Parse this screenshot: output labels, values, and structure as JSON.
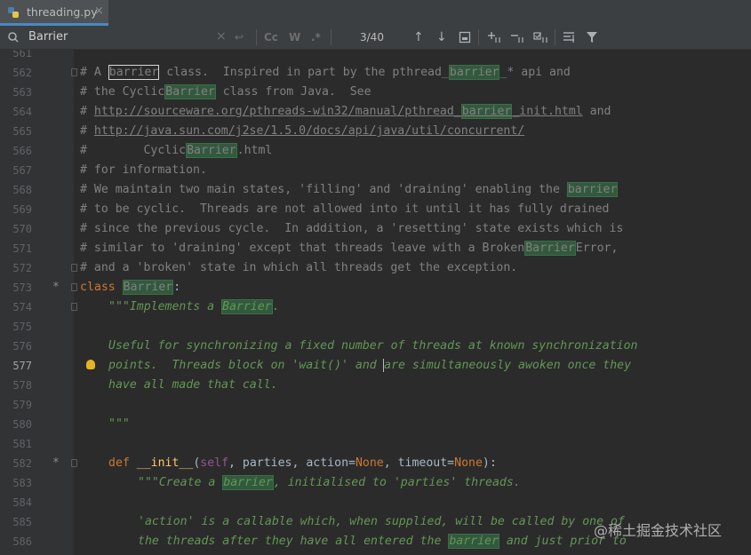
{
  "tab": {
    "filename": "threading.py",
    "close": "×"
  },
  "search": {
    "query": "Barrier",
    "match_count": "3/40",
    "clear_icon": "×",
    "history_icon": "↩",
    "match_case": "Cc",
    "whole_word": "W",
    "regex": ".*",
    "prev_icon": "↑",
    "next_icon": "↓"
  },
  "editor": {
    "current_line": "577",
    "lines": [
      {
        "n": "561"
      },
      {
        "n": "562",
        "a": "# A ",
        "b": "barrier",
        "c": " class.  Inspired in part by the pthread_",
        "d": "barrier",
        "e": "_* api and"
      },
      {
        "n": "563",
        "a": "# the Cyclic",
        "b": "Barrier",
        "c": " class from Java.  See"
      },
      {
        "n": "564",
        "a": "# ",
        "l1": "http://sourceware.org/pthreads-win32/manual/pthread_",
        "b": "barrier",
        "l2": "_init.html",
        "c": " and"
      },
      {
        "n": "565",
        "a": "# ",
        "l": "http://java.sun.com/j2se/1.5.0/docs/api/java/util/concurrent/"
      },
      {
        "n": "566",
        "a": "#        Cyclic",
        "b": "Barrier",
        "c": ".html"
      },
      {
        "n": "567",
        "a": "# for information."
      },
      {
        "n": "568",
        "a": "# We maintain two main states, 'filling' and 'draining' enabling the ",
        "b": "barrier"
      },
      {
        "n": "569",
        "a": "# to be cyclic.  Threads are not allowed into it until it has fully drained"
      },
      {
        "n": "570",
        "a": "# since the previous cycle.  In addition, a 'resetting' state exists which is"
      },
      {
        "n": "571",
        "a": "# similar to 'draining' except that threads leave with a Broken",
        "b": "Barrier",
        "c": "Error,"
      },
      {
        "n": "572",
        "a": "# and a 'broken' state in which all threads get the exception."
      },
      {
        "n": "573",
        "kw": "class",
        "sp": " ",
        "b": "Barrier",
        "c": ":"
      },
      {
        "n": "574",
        "a": "\"\"\"Implements a ",
        "b": "Barrier",
        "c": "."
      },
      {
        "n": "575"
      },
      {
        "n": "576",
        "a": "Useful for synchronizing a fixed number of threads at known synchronization"
      },
      {
        "n": "577",
        "a": "points.  Threads block on 'wait()' and ",
        "c": "are simultaneously awoken once they"
      },
      {
        "n": "578",
        "a": "have all made that call."
      },
      {
        "n": "579"
      },
      {
        "n": "580",
        "a": "\"\"\""
      },
      {
        "n": "581"
      },
      {
        "n": "582",
        "kw": "def",
        "fn": "__init__",
        "self": "self",
        "rest1": ", parties, action=",
        "none1": "None",
        "rest2": ", timeout=",
        "none2": "None",
        "end": "):"
      },
      {
        "n": "583",
        "a": "\"\"\"Create a ",
        "b": "barrier",
        "c": ", initialised to 'parties' threads."
      },
      {
        "n": "584"
      },
      {
        "n": "585",
        "a": "'action' is a callable which, when supplied, will be called by one of"
      },
      {
        "n": "586",
        "a": "the threads after they have all entered the ",
        "b": "barrier",
        "c": " and just prior to"
      }
    ]
  },
  "watermark": "@稀土掘金技术社区"
}
